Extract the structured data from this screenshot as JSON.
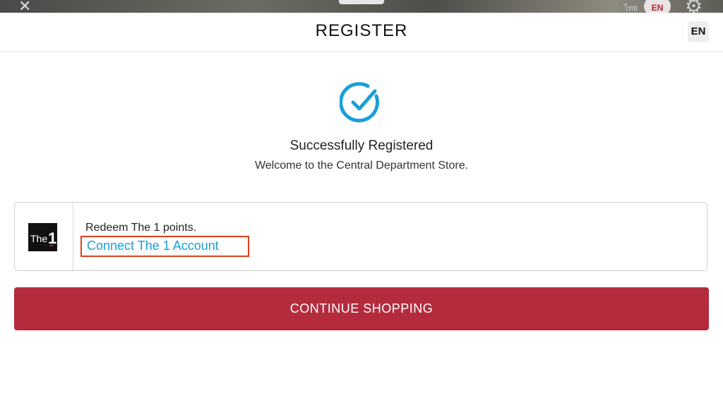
{
  "background": {
    "lang_thai": "ไทย",
    "lang_en": "EN"
  },
  "header": {
    "title": "REGISTER",
    "lang_label": "EN"
  },
  "success": {
    "title": "Successfully Registered",
    "subtitle": "Welcome to the Central Department Store.",
    "accent_color": "#1a9fd8"
  },
  "the1_card": {
    "logo_text": "The",
    "logo_number": "1",
    "description": "Redeem The 1 points.",
    "link_label": "Connect The 1 Account",
    "highlight_color": "#e0411e"
  },
  "continue_button": {
    "label": "CONTINUE SHOPPING",
    "color": "#b42b3e"
  }
}
